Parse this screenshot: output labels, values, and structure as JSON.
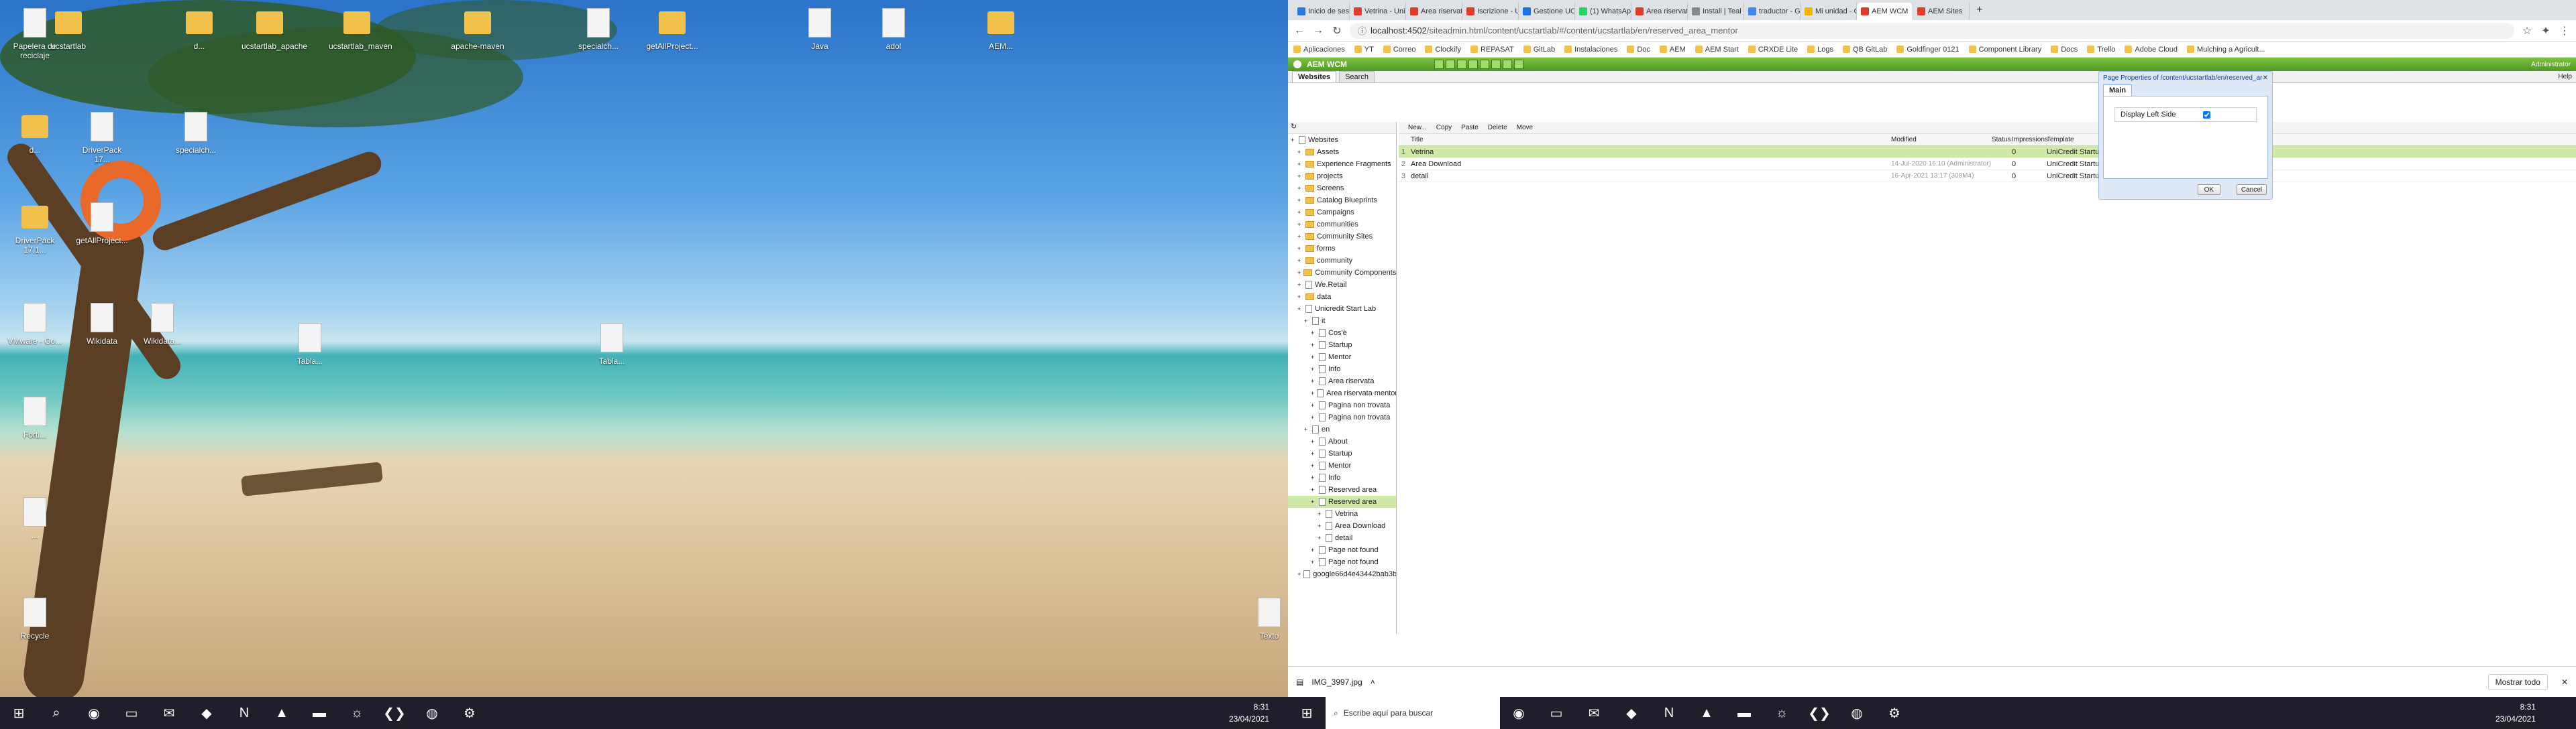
{
  "left": {
    "desktop_icons": [
      {
        "label": "Papelera de reciclaje",
        "type": "doc"
      },
      {
        "label": "ucstartlab",
        "type": "fold"
      },
      {
        "label": "d...",
        "type": "fold"
      },
      {
        "label": "ucstartlab_apache",
        "type": "fold"
      },
      {
        "label": "ucstartlab_maven",
        "type": "fold"
      },
      {
        "label": "apache-maven",
        "type": "fold"
      },
      {
        "label": "specialch...",
        "type": "doc"
      },
      {
        "label": "getAllProject...",
        "type": "fold"
      },
      {
        "label": "Java",
        "type": "doc"
      },
      {
        "label": "adol",
        "type": "doc"
      },
      {
        "label": "AEM...",
        "type": "fold"
      },
      {
        "label": "d...",
        "type": "fold"
      },
      {
        "label": "DriverPack 17...",
        "type": "doc"
      },
      {
        "label": "specialch...",
        "type": "doc"
      },
      {
        "label": "DriverPack 17.1...",
        "type": "fold"
      },
      {
        "label": "getAllProject...",
        "type": "doc"
      },
      {
        "label": "VMware - Go...",
        "type": "doc"
      },
      {
        "label": "Wikidata",
        "type": "doc"
      },
      {
        "label": "Wikidata...",
        "type": "doc"
      },
      {
        "label": "Forti...",
        "type": "doc"
      },
      {
        "label": "...",
        "type": "doc"
      },
      {
        "label": "Recycle",
        "type": "doc"
      },
      {
        "label": "Texto",
        "type": "doc"
      },
      {
        "label": "Tabla...",
        "type": "doc"
      },
      {
        "label": "Tabla...",
        "type": "doc"
      }
    ],
    "clock": {
      "time": "8:31",
      "date": "23/04/2021"
    }
  },
  "browser": {
    "tabs": [
      "Inicio de sesi",
      "Vetrina - Uni",
      "Area riservat",
      "Iscrizione - U",
      "Gestione UC",
      "(1) WhatsApp",
      "Area riservat",
      "Install | Teal",
      "traductor - G",
      "Mi unidad - C",
      "AEM WCM",
      "AEM Sites"
    ],
    "active_tab": 10,
    "url_host": "localhost:4502",
    "url_path": "/siteadmin.html/content/ucstartlab/#/content/ucstartlab/en/reserved_area_mentor",
    "bookmarks": [
      "Aplicaciones",
      "YT",
      "Correo",
      "Clockify",
      "REPASAT",
      "GitLab",
      "Instalaciones",
      "Doc",
      "AEM",
      "AEM Start",
      "CRXDE Lite",
      "Logs",
      "QB GitLab",
      "Goldfinger 0121",
      "Component Library",
      "Docs",
      "Trello",
      "Adobe Cloud",
      "Mulching a Agricult..."
    ]
  },
  "aem": {
    "brand": "AEM WCM",
    "user": "Administrator",
    "tabs": [
      "Websites",
      "Search"
    ],
    "help": "Help",
    "grid_tools": [
      "New...",
      "Copy",
      "Paste",
      "Delete",
      "Move"
    ],
    "columns": {
      "title": "Title",
      "modified": "Modified",
      "status": "Status",
      "impressions": "Impressions",
      "template": "Template"
    },
    "rows": [
      {
        "num": "1",
        "title": "Vetrina",
        "modified": "",
        "status": "",
        "impressions": "0",
        "template": "UniCredit Startup Lab internal Without Sidebar"
      },
      {
        "num": "2",
        "title": "Area Download",
        "modified": "14-Jul-2020 16:10 (Administrator)",
        "status": "",
        "impressions": "0",
        "template": "UniCredit Startup Lab internal Without Sidebar"
      },
      {
        "num": "3",
        "title": "detail",
        "modified": "16-Apr-2021 13:17 (308M4)",
        "status": "",
        "impressions": "0",
        "template": "UniCredit Startup Lab Detail Startup"
      }
    ],
    "tree": [
      {
        "label": "Websites",
        "d": 0,
        "t": "pi"
      },
      {
        "label": "Assets",
        "d": 1,
        "t": "fi"
      },
      {
        "label": "Experience Fragments",
        "d": 1,
        "t": "fi"
      },
      {
        "label": "projects",
        "d": 1,
        "t": "fi"
      },
      {
        "label": "Screens",
        "d": 1,
        "t": "fi"
      },
      {
        "label": "Catalog Blueprints",
        "d": 1,
        "t": "fi"
      },
      {
        "label": "Campaigns",
        "d": 1,
        "t": "fi"
      },
      {
        "label": "communities",
        "d": 1,
        "t": "fi"
      },
      {
        "label": "Community Sites",
        "d": 1,
        "t": "fi"
      },
      {
        "label": "forms",
        "d": 1,
        "t": "fi"
      },
      {
        "label": "community",
        "d": 1,
        "t": "fi"
      },
      {
        "label": "Community Components",
        "d": 1,
        "t": "fi"
      },
      {
        "label": "We.Retail",
        "d": 1,
        "t": "pi"
      },
      {
        "label": "data",
        "d": 1,
        "t": "fi"
      },
      {
        "label": "Unicredit Start Lab",
        "d": 1,
        "t": "pi"
      },
      {
        "label": "it",
        "d": 2,
        "t": "pi"
      },
      {
        "label": "Cos'è",
        "d": 3,
        "t": "pi"
      },
      {
        "label": "Startup",
        "d": 3,
        "t": "pi"
      },
      {
        "label": "Mentor",
        "d": 3,
        "t": "pi"
      },
      {
        "label": "Info",
        "d": 3,
        "t": "pi"
      },
      {
        "label": "Area riservata",
        "d": 3,
        "t": "pi"
      },
      {
        "label": "Area riservata mentor",
        "d": 3,
        "t": "pi"
      },
      {
        "label": "Pagina non trovata",
        "d": 3,
        "t": "pi"
      },
      {
        "label": "Pagina non trovata",
        "d": 3,
        "t": "pi"
      },
      {
        "label": "en",
        "d": 2,
        "t": "pi"
      },
      {
        "label": "About",
        "d": 3,
        "t": "pi"
      },
      {
        "label": "Startup",
        "d": 3,
        "t": "pi"
      },
      {
        "label": "Mentor",
        "d": 3,
        "t": "pi"
      },
      {
        "label": "Info",
        "d": 3,
        "t": "pi"
      },
      {
        "label": "Reserved area",
        "d": 3,
        "t": "pi"
      },
      {
        "label": "Reserved area",
        "d": 3,
        "t": "pi",
        "sel": true
      },
      {
        "label": "Vetrina",
        "d": 4,
        "t": "pi"
      },
      {
        "label": "Area Download",
        "d": 4,
        "t": "pi"
      },
      {
        "label": "detail",
        "d": 4,
        "t": "pi"
      },
      {
        "label": "Page not found",
        "d": 3,
        "t": "pi"
      },
      {
        "label": "Page not found",
        "d": 3,
        "t": "pi"
      },
      {
        "label": "google66d4e43442bab3b.html",
        "d": 1,
        "t": "pi"
      }
    ]
  },
  "dialog": {
    "title": "Page Properties of /content/ucstartlab/en/reserved_area_mentor/vetrina",
    "tab": "Main",
    "field_label": "Display Left Side",
    "ok": "OK",
    "cancel": "Cancel"
  },
  "downloads": {
    "file": "IMG_3997.jpg",
    "show_all": "Mostrar todo"
  },
  "right_taskbar": {
    "search_placeholder": "Escribe aquí para buscar",
    "time": "8:31",
    "date": "23/04/2021"
  },
  "colors": {
    "aem_green": "#5ca52d",
    "selection": "#cfe9a8",
    "taskbar": "#1f1f2b"
  }
}
